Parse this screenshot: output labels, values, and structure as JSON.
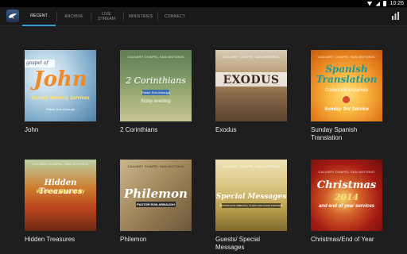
{
  "status": {
    "time": "10:26"
  },
  "tabs": [
    {
      "label": "RECENT"
    },
    {
      "label": "ARCHIVE"
    },
    {
      "label": "LIVE\nSTREAM"
    },
    {
      "label": "MINISTRIES"
    },
    {
      "label": "CONNECT"
    }
  ],
  "cards": [
    {
      "caption": "John",
      "cover": {
        "top": "gospel of",
        "title": "John",
        "sub": "Sunday Morning Services",
        "pastor": "Pastor Ron Arbaugh"
      }
    },
    {
      "caption": "2 Corinthians",
      "cover": {
        "brand": "CALVARY CHAPEL SAN ANTONIO",
        "title": "2 Corinthians",
        "sub": "friday evening",
        "pastor": "Pastor Ron Arbaugh"
      }
    },
    {
      "caption": "Exodus",
      "cover": {
        "brand": "CALVARY CHAPEL SAN ANTONIO",
        "title": "EXODUS"
      }
    },
    {
      "caption": "Sunday Spanish\nTranslation",
      "cover": {
        "brand": "CALVARY CHAPEL SAN ANTONIO",
        "title": "Spanish",
        "title2": "Translation",
        "sub": "traducción española",
        "sub2": "Sunday 3rd Service"
      }
    },
    {
      "caption": "Hidden Treasures",
      "cover": {
        "brand": "CALVARY CHAPEL SAN ANTONIO",
        "title": "Hidden Treasures",
        "sub": "Women's Bible Study"
      }
    },
    {
      "caption": "Philemon",
      "cover": {
        "brand": "CALVARY CHAPEL SAN ANTONIO",
        "title": "Philemon",
        "sub": "PASTOR RON ARBAUGH"
      }
    },
    {
      "caption": "Guests/ Special\nMessages",
      "cover": {
        "brand": "CALVARY CHAPEL SAN ANTONIO",
        "title": "Special Messages",
        "sub": "PASTOR RON ARBAUGH, GUEST AND STAFF PASTORS"
      }
    },
    {
      "caption": "Christmas/End of Year",
      "cover": {
        "brand": "CALVARY CHAPEL SAN ANTONIO",
        "title": "Christmas",
        "title2": "2014",
        "sub": "and end of year services"
      }
    }
  ]
}
